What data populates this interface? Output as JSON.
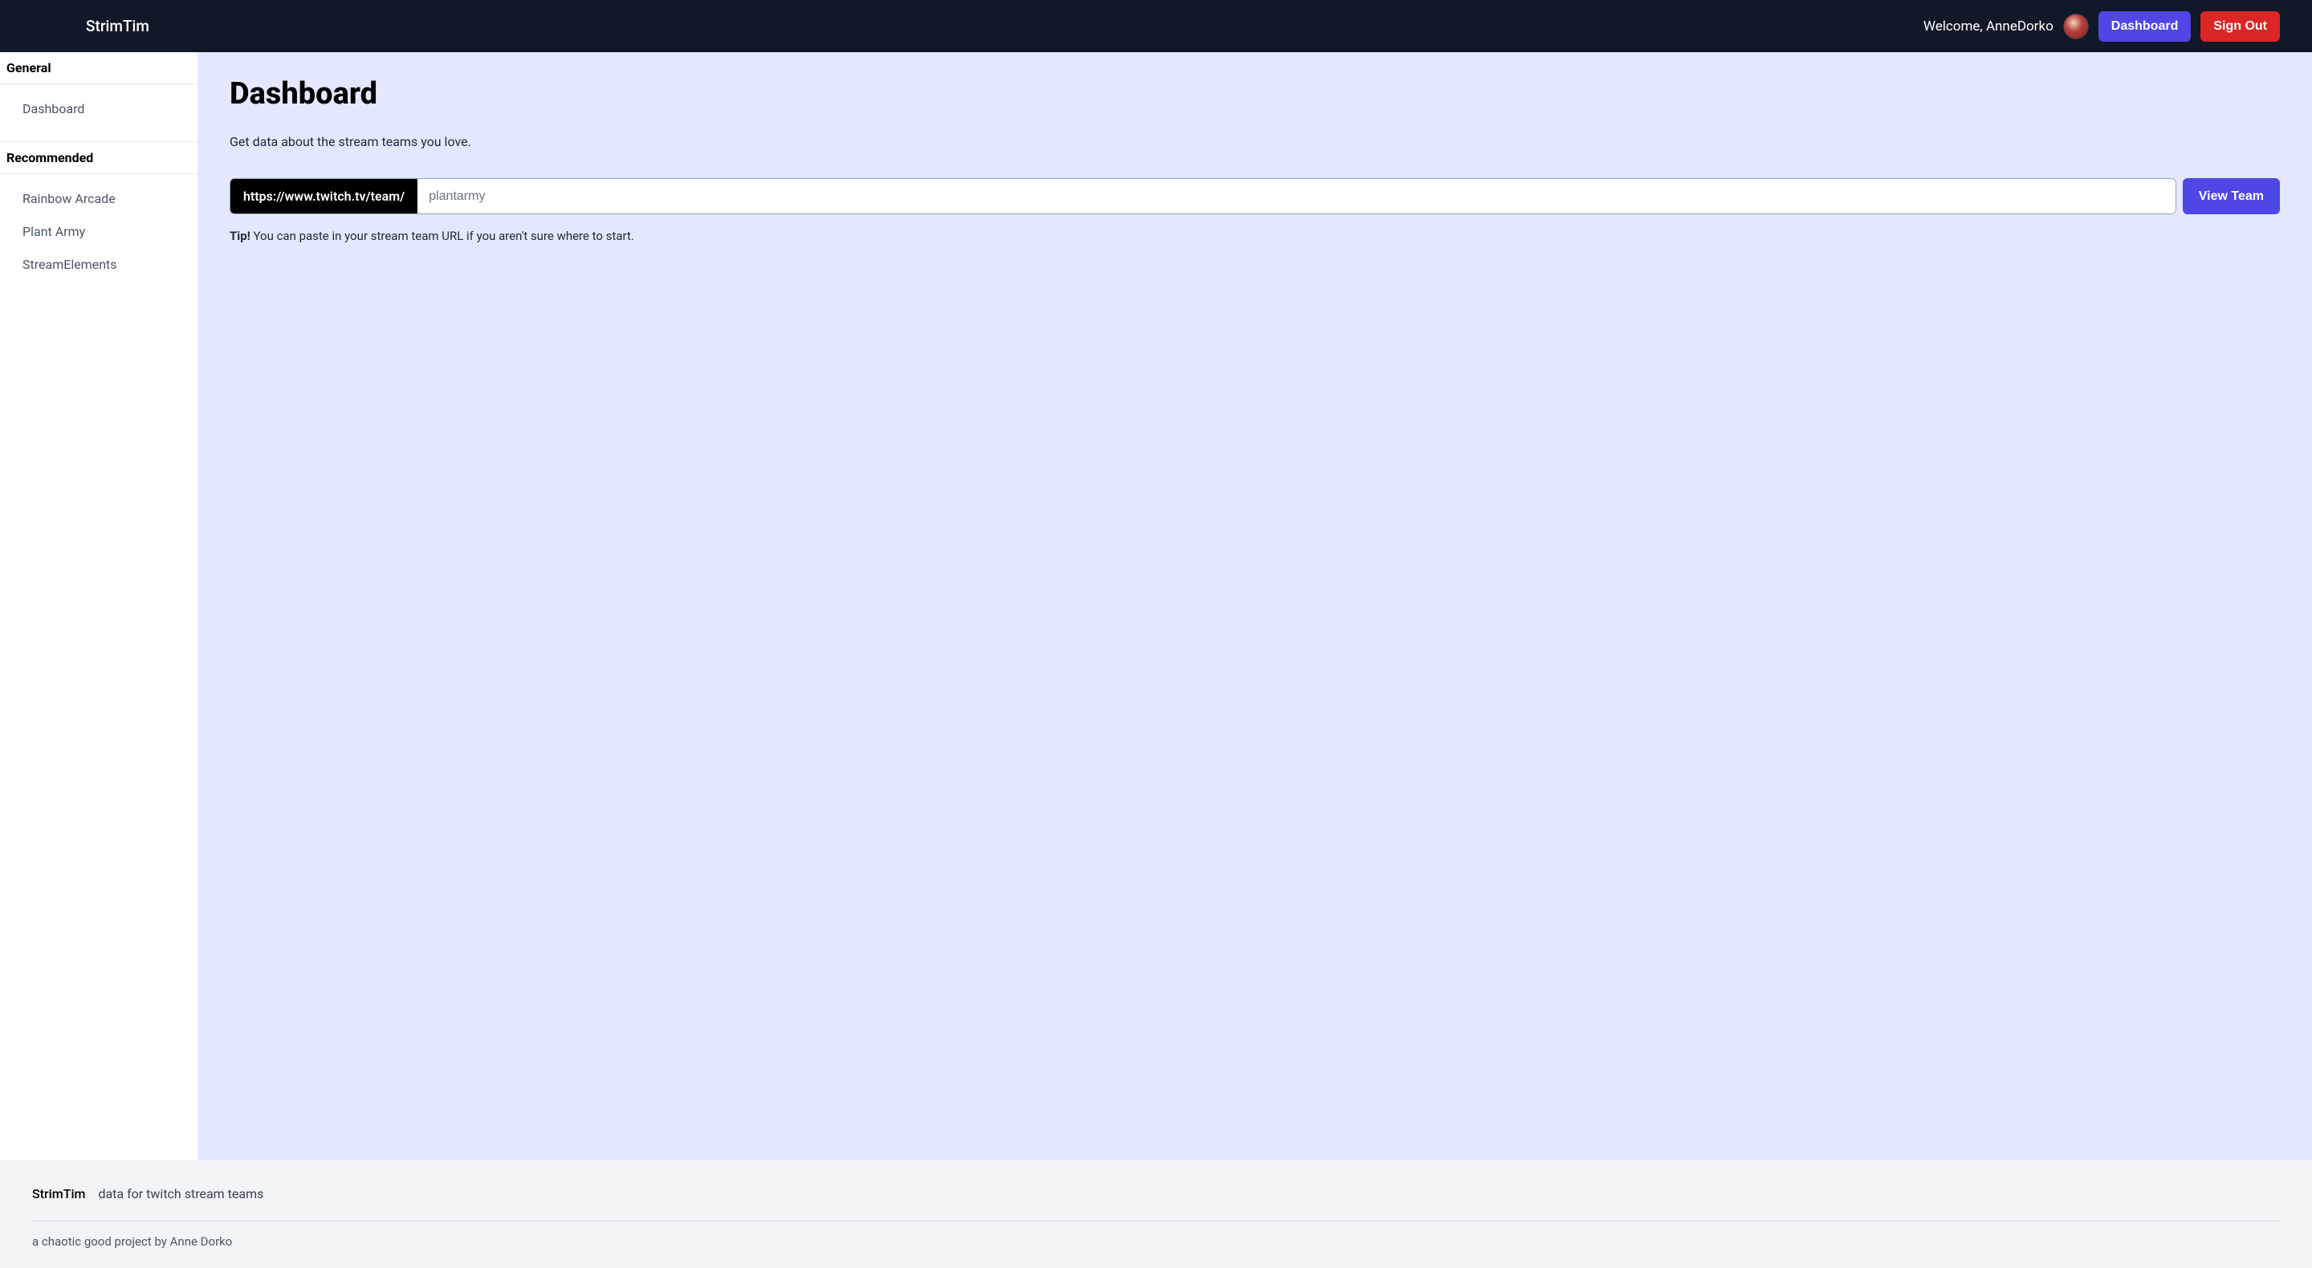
{
  "header": {
    "brand": "StrimTim",
    "welcome_prefix": "Welcome, ",
    "username": "AnneDorko",
    "dashboard_label": "Dashboard",
    "signout_label": "Sign Out"
  },
  "sidebar": {
    "sections": [
      {
        "title": "General",
        "items": [
          {
            "label": "Dashboard"
          }
        ]
      },
      {
        "title": "Recommended",
        "items": [
          {
            "label": "Rainbow Arcade"
          },
          {
            "label": "Plant Army"
          },
          {
            "label": "StreamElements"
          }
        ]
      }
    ]
  },
  "main": {
    "title": "Dashboard",
    "subtitle": "Get data about the stream teams you love.",
    "input_addon": "https://www.twitch.tv/team/",
    "input_placeholder": "plantarmy",
    "input_value": "",
    "view_team_label": "View Team",
    "tip_label": "Tip!",
    "tip_text": " You can paste in your stream team URL if you aren't sure where to start."
  },
  "footer": {
    "brand": "StrimTim",
    "tagline": "data for twitch stream teams",
    "credit": "a chaotic good project by Anne Dorko"
  }
}
